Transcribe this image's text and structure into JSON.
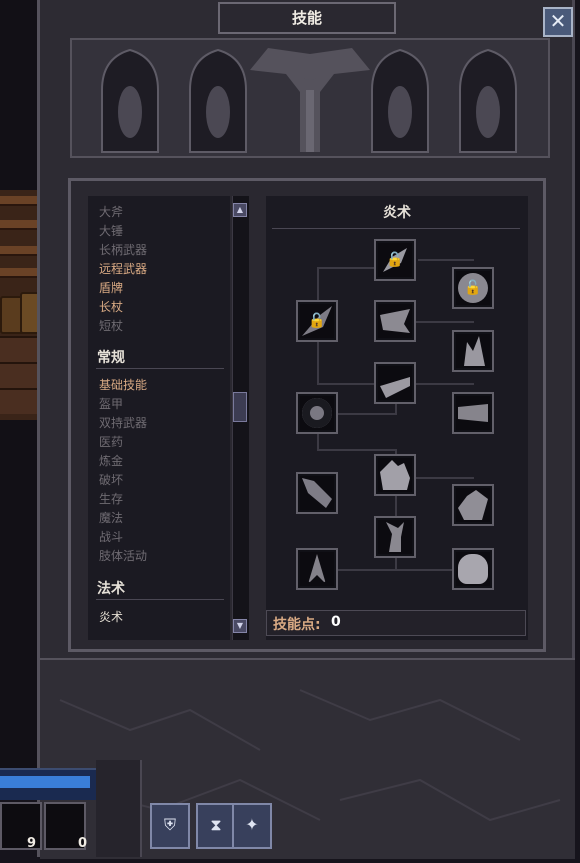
{
  "window": {
    "title": "技能",
    "close_symbol": "✕"
  },
  "skill_list": {
    "weapons_items": [
      {
        "label": "大斧",
        "state": "locked"
      },
      {
        "label": "大锤",
        "state": "locked"
      },
      {
        "label": "长柄武器",
        "state": "locked"
      },
      {
        "label": "远程武器",
        "state": "learnable"
      },
      {
        "label": "盾牌",
        "state": "learnable"
      },
      {
        "label": "长杖",
        "state": "learnable"
      },
      {
        "label": "短杖",
        "state": "locked"
      }
    ],
    "general_header": "常规",
    "general_items": [
      {
        "label": "基础技能",
        "state": "learnable"
      },
      {
        "label": "盔甲",
        "state": "locked"
      },
      {
        "label": "双持武器",
        "state": "locked"
      },
      {
        "label": "医药",
        "state": "locked"
      },
      {
        "label": "炼金",
        "state": "locked"
      },
      {
        "label": "破坏",
        "state": "locked"
      },
      {
        "label": "生存",
        "state": "locked"
      },
      {
        "label": "魔法",
        "state": "locked"
      },
      {
        "label": "战斗",
        "state": "locked"
      },
      {
        "label": "肢体活动",
        "state": "locked"
      }
    ],
    "spells_header": "法术",
    "spells_items": [
      {
        "label": "炎术",
        "state": "selected"
      }
    ]
  },
  "tree": {
    "title": "炎术",
    "skills": [
      {
        "name": "fire-skill-1",
        "locked": true
      },
      {
        "name": "fire-skill-2",
        "locked": true
      },
      {
        "name": "fire-skill-3",
        "locked": true
      },
      {
        "name": "fire-skill-4",
        "locked": false
      },
      {
        "name": "fire-skill-5",
        "locked": false
      },
      {
        "name": "fire-skill-6",
        "locked": false
      },
      {
        "name": "fire-skill-7",
        "locked": false
      },
      {
        "name": "fire-skill-8",
        "locked": false
      },
      {
        "name": "fire-skill-9",
        "locked": false
      },
      {
        "name": "fire-skill-10",
        "locked": false
      },
      {
        "name": "fire-skill-11",
        "locked": false
      },
      {
        "name": "fire-skill-12",
        "locked": false
      },
      {
        "name": "fire-skill-13",
        "locked": false
      },
      {
        "name": "fire-skill-14",
        "locked": false
      }
    ],
    "lock_symbol": "🔓"
  },
  "skill_points": {
    "label": "技能点:",
    "value": "0"
  },
  "hud": {
    "slot_left_value": "9",
    "slot_right_value": "0",
    "buttons": [
      "shield-icon",
      "hourglass-icon",
      "sparkle-icon"
    ]
  }
}
